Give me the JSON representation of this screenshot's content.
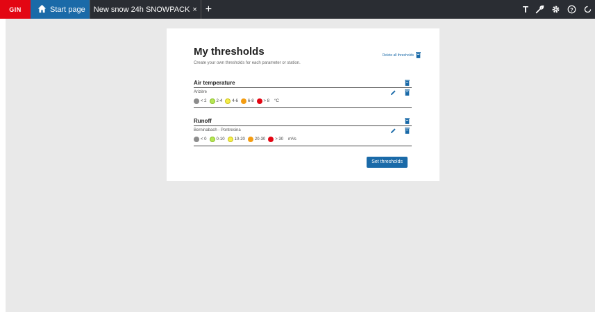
{
  "topbar": {
    "logo": "GIN",
    "tabs": [
      {
        "label": "Start page"
      },
      {
        "label": "New snow 24h SNOWPACK",
        "close": "×"
      }
    ],
    "add_tab": "+",
    "right_icons": [
      {
        "name": "text-icon",
        "glyph": "T"
      },
      {
        "name": "wrench-icon"
      },
      {
        "name": "gear-icon"
      },
      {
        "name": "help-icon",
        "glyph": "?"
      },
      {
        "name": "account-icon"
      }
    ],
    "colors": {
      "bar": "#2a2d33",
      "logo": "#e30613",
      "active_tab": "#1a6aa8"
    }
  },
  "panel": {
    "title": "My thresholds",
    "subtitle": "Create your own thresholds for each parameter or station.",
    "delete_all_label": "Delete all thresholds",
    "sections": [
      {
        "parameter": "Air temperature",
        "station": "Arizère",
        "unit": "°C",
        "levels": [
          {
            "color": "#8c8c8c",
            "label": "< 2"
          },
          {
            "color": "#b5e655",
            "label": "2-4"
          },
          {
            "color": "#f5ee4a",
            "label": "4-6"
          },
          {
            "color": "#f39c12",
            "label": "6-8"
          },
          {
            "color": "#e30613",
            "label": "> 8"
          }
        ]
      },
      {
        "parameter": "Runoff",
        "station": "Berninabach - Pontresina",
        "unit": "m³/s",
        "levels": [
          {
            "color": "#8c8c8c",
            "label": "< 0"
          },
          {
            "color": "#b5e655",
            "label": "0-10"
          },
          {
            "color": "#f5ee4a",
            "label": "10-20"
          },
          {
            "color": "#f39c12",
            "label": "20-30"
          },
          {
            "color": "#e30613",
            "label": "> 30"
          }
        ]
      }
    ],
    "set_button_label": "Set thresholds"
  }
}
